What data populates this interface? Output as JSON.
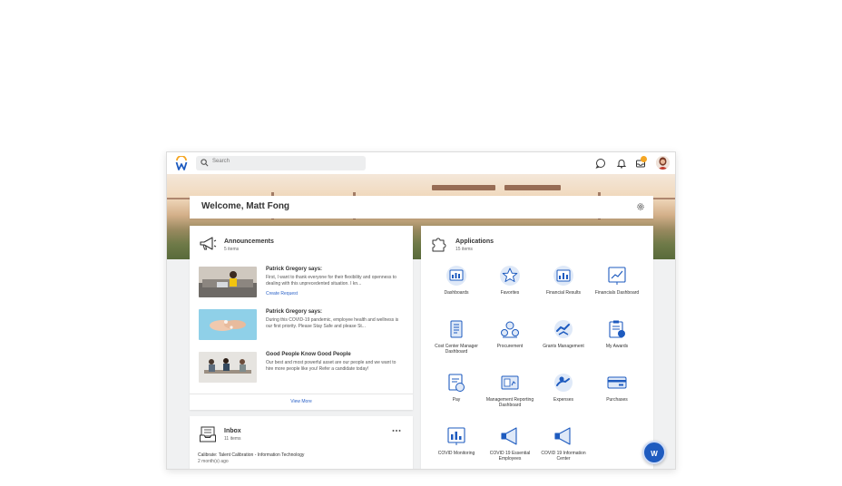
{
  "search": {
    "placeholder": "Search"
  },
  "welcome": {
    "title": "Welcome, Matt Fong"
  },
  "announcements": {
    "title": "Announcements",
    "count": "5 items",
    "items": [
      {
        "author": "Patrick Gregory says:",
        "text": "First, I want to thank everyone for their flexibility and openness to dealing with this unprecedented situation. I kn...",
        "link": "Create Request"
      },
      {
        "author": "Patrick Gregory says:",
        "text": "During this COVID-19 pandemic, employee health and wellness is our first priority. Please Stay Safe and please St...",
        "link": ""
      },
      {
        "author": "Good People Know Good People",
        "text": "Our best and most powerful asset are our people and we want to hire more people like you! Refer a candidate today!",
        "link": ""
      }
    ],
    "view_more": "View More"
  },
  "inbox": {
    "title": "Inbox",
    "count": "11 items",
    "item_title": "Calibrate: Talent Calibration - Information Technology",
    "item_time": "2 month(s) ago"
  },
  "applications": {
    "title": "Applications",
    "count": "15 items",
    "apps": [
      {
        "label": "Dashboards",
        "icon": "dashboards-icon"
      },
      {
        "label": "Favorites",
        "icon": "star-icon"
      },
      {
        "label": "Financial Results",
        "icon": "financial-results-icon"
      },
      {
        "label": "Financials Dashboard",
        "icon": "financials-dashboard-icon"
      },
      {
        "label": "Cost Center Manager Dashboard",
        "icon": "cost-center-icon"
      },
      {
        "label": "Procurement",
        "icon": "procurement-icon"
      },
      {
        "label": "Grants Management",
        "icon": "grants-icon"
      },
      {
        "label": "My Awards",
        "icon": "awards-icon"
      },
      {
        "label": "Pay",
        "icon": "pay-icon"
      },
      {
        "label": "Management Reporting Dashboard",
        "icon": "reporting-icon"
      },
      {
        "label": "Expenses",
        "icon": "expenses-icon"
      },
      {
        "label": "Purchases",
        "icon": "purchases-icon"
      },
      {
        "label": "COVID Monitoring",
        "icon": "monitoring-icon"
      },
      {
        "label": "COVID 19 Essential Employees",
        "icon": "megaphone-icon"
      },
      {
        "label": "COVID 19 Information Center",
        "icon": "megaphone-icon"
      }
    ]
  },
  "colors": {
    "accent": "#1e5bbf",
    "badge": "#f5a623",
    "link": "#2c63c8"
  },
  "fab": {
    "letter": "W"
  }
}
